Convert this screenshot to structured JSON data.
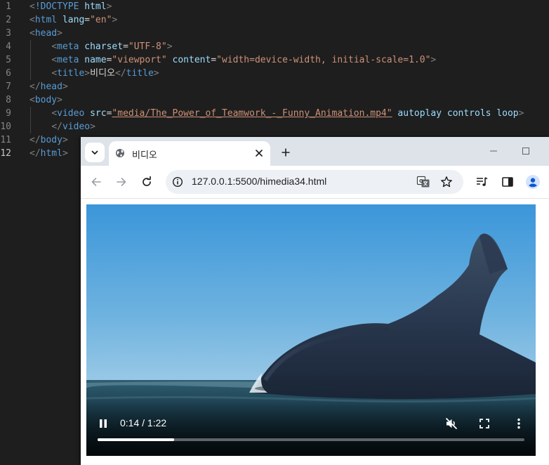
{
  "editor": {
    "lines": [
      {
        "n": "1",
        "parts": [
          [
            "t-brk",
            "<"
          ],
          [
            "t-tag",
            "!DOCTYPE"
          ],
          [
            "t-txt",
            " "
          ],
          [
            "t-attr",
            "html"
          ],
          [
            "t-brk",
            ">"
          ]
        ]
      },
      {
        "n": "2",
        "parts": [
          [
            "t-brk",
            "<"
          ],
          [
            "t-tag",
            "html"
          ],
          [
            "t-txt",
            " "
          ],
          [
            "t-attr",
            "lang"
          ],
          [
            "t-eq",
            "="
          ],
          [
            "t-str",
            "\"en\""
          ],
          [
            "t-brk",
            ">"
          ]
        ]
      },
      {
        "n": "3",
        "parts": [
          [
            "t-brk",
            "<"
          ],
          [
            "t-tag",
            "head"
          ],
          [
            "t-brk",
            ">"
          ]
        ]
      },
      {
        "n": "4",
        "parts": [
          [
            "t-txt",
            "    "
          ],
          [
            "t-brk",
            "<"
          ],
          [
            "t-tag",
            "meta"
          ],
          [
            "t-txt",
            " "
          ],
          [
            "t-attr",
            "charset"
          ],
          [
            "t-eq",
            "="
          ],
          [
            "t-str",
            "\"UTF-8\""
          ],
          [
            "t-brk",
            ">"
          ]
        ]
      },
      {
        "n": "5",
        "parts": [
          [
            "t-txt",
            "    "
          ],
          [
            "t-brk",
            "<"
          ],
          [
            "t-tag",
            "meta"
          ],
          [
            "t-txt",
            " "
          ],
          [
            "t-attr",
            "name"
          ],
          [
            "t-eq",
            "="
          ],
          [
            "t-str",
            "\"viewport\""
          ],
          [
            "t-txt",
            " "
          ],
          [
            "t-attr",
            "content"
          ],
          [
            "t-eq",
            "="
          ],
          [
            "t-str",
            "\"width=device-width, initial-scale=1.0\""
          ],
          [
            "t-brk",
            ">"
          ]
        ]
      },
      {
        "n": "6",
        "parts": [
          [
            "t-txt",
            "    "
          ],
          [
            "t-brk",
            "<"
          ],
          [
            "t-tag",
            "title"
          ],
          [
            "t-brk",
            ">"
          ],
          [
            "t-txt",
            "비디오"
          ],
          [
            "t-brk",
            "</"
          ],
          [
            "t-tag",
            "title"
          ],
          [
            "t-brk",
            ">"
          ]
        ]
      },
      {
        "n": "7",
        "parts": [
          [
            "t-brk",
            "</"
          ],
          [
            "t-tag",
            "head"
          ],
          [
            "t-brk",
            ">"
          ]
        ]
      },
      {
        "n": "8",
        "parts": [
          [
            "t-brk",
            "<"
          ],
          [
            "t-tag",
            "body"
          ],
          [
            "t-brk",
            ">"
          ]
        ]
      },
      {
        "n": "9",
        "parts": [
          [
            "t-txt",
            "    "
          ],
          [
            "t-brk",
            "<"
          ],
          [
            "t-tag",
            "video"
          ],
          [
            "t-txt",
            " "
          ],
          [
            "t-attr",
            "src"
          ],
          [
            "t-eq",
            "="
          ],
          [
            "t-str u",
            "\"media/The_Power_of_Teamwork_-_Funny_Animation.mp4\""
          ],
          [
            "t-txt",
            " "
          ],
          [
            "t-attr",
            "autoplay"
          ],
          [
            "t-txt",
            " "
          ],
          [
            "t-attr",
            "controls"
          ],
          [
            "t-txt",
            " "
          ],
          [
            "t-attr",
            "loop"
          ],
          [
            "t-brk",
            ">"
          ]
        ]
      },
      {
        "n": "10",
        "parts": [
          [
            "t-txt",
            "    "
          ],
          [
            "t-brk",
            "</"
          ],
          [
            "t-tag",
            "video"
          ],
          [
            "t-brk",
            ">"
          ]
        ]
      },
      {
        "n": "11",
        "parts": [
          [
            "t-brk",
            "</"
          ],
          [
            "t-tag",
            "body"
          ],
          [
            "t-brk",
            ">"
          ]
        ]
      },
      {
        "n": "12",
        "parts": [
          [
            "t-brk",
            "</"
          ],
          [
            "t-tag",
            "html"
          ],
          [
            "t-brk",
            ">"
          ]
        ]
      }
    ],
    "active_line": "12"
  },
  "browser": {
    "tab_title": "비디오",
    "url": "127.0.0.1:5500/himedia34.html"
  },
  "video": {
    "time": "0:14 / 1:22",
    "progress": 0.18,
    "buffered": 0.18
  },
  "icons": {
    "tab_search": "chevron-down-icon",
    "tab_favicon": "globe-icon",
    "tab_close": "close-icon",
    "new_tab": "plus-icon",
    "back": "arrow-left-icon",
    "forward": "arrow-right-icon",
    "reload": "reload-icon",
    "site_info": "site-info-icon",
    "translate": "translate-icon",
    "bookmark": "star-icon",
    "media": "media-queue-icon",
    "side_panel": "side-panel-icon",
    "profile": "profile-icon",
    "pause": "pause-icon",
    "mute": "volume-muted-icon",
    "fullscreen": "fullscreen-icon",
    "more": "more-vertical-icon"
  },
  "colors": {
    "editor_bg": "#1e1e1e",
    "tab_strip": "#dee3ea",
    "omnibox": "#edf0f5",
    "profile_accent": "#0b57d0"
  }
}
